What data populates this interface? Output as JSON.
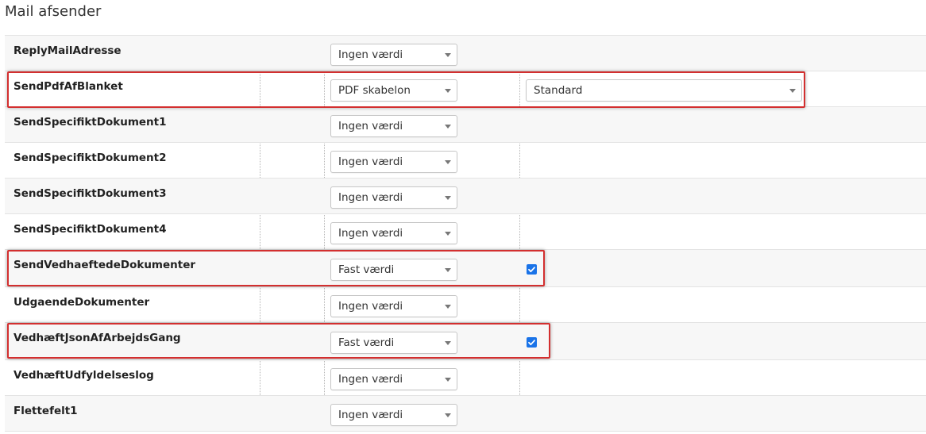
{
  "page": {
    "title": "Mail afsender"
  },
  "rows": [
    {
      "label": "ReplyMailAdresse",
      "select": "Ingen værdi"
    },
    {
      "label": "SendPdfAfBlanket",
      "select": "PDF skabelon",
      "extra_select": "Standard"
    },
    {
      "label": "SendSpecifiktDokument1",
      "select": "Ingen værdi"
    },
    {
      "label": "SendSpecifiktDokument2",
      "select": "Ingen værdi"
    },
    {
      "label": "SendSpecifiktDokument3",
      "select": "Ingen værdi"
    },
    {
      "label": "SendSpecifiktDokument4",
      "select": "Ingen værdi"
    },
    {
      "label": "SendVedhaeftedeDokumenter",
      "select": "Fast værdi",
      "checked": true
    },
    {
      "label": "UdgaendeDokumenter",
      "select": "Ingen værdi"
    },
    {
      "label": "VedhæftJsonAfArbejdsGang",
      "select": "Fast værdi",
      "checked": true
    },
    {
      "label": "VedhæftUdfyldelseslog",
      "select": "Ingen værdi"
    },
    {
      "label": "Flettefelt1",
      "select": "Ingen værdi"
    }
  ],
  "colors": {
    "highlight": "#d32f2f",
    "checkbox": "#1a73e8",
    "row_alt": "#f7f7f7"
  }
}
